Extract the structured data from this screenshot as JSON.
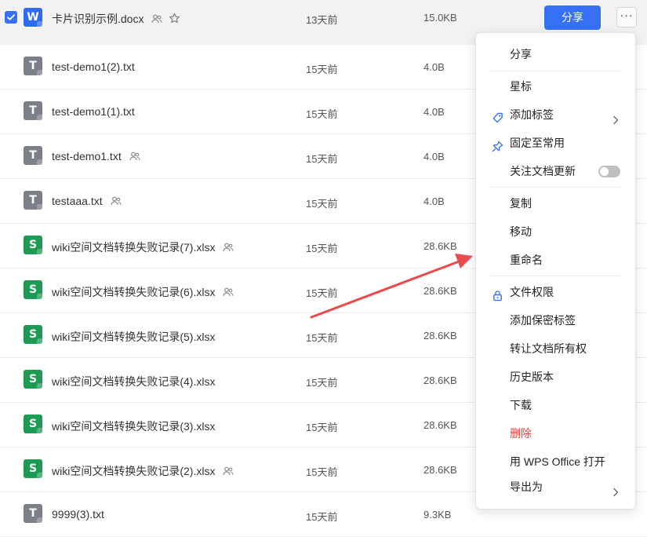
{
  "files": [
    {
      "type": "W",
      "name": "卡片识别示例.docx",
      "time": "13天前",
      "size": "15.0KB",
      "shared": true,
      "star": true,
      "selected": true
    },
    {
      "type": "T",
      "name": "test-demo1(2).txt",
      "time": "15天前",
      "size": "4.0B",
      "shared": false
    },
    {
      "type": "T",
      "name": "test-demo1(1).txt",
      "time": "15天前",
      "size": "4.0B",
      "shared": false
    },
    {
      "type": "T",
      "name": "test-demo1.txt",
      "time": "15天前",
      "size": "4.0B",
      "shared": true
    },
    {
      "type": "T",
      "name": "testaaa.txt",
      "time": "15天前",
      "size": "4.0B",
      "shared": true
    },
    {
      "type": "S",
      "name": "wiki空间文档转换失败记录(7).xlsx",
      "time": "15天前",
      "size": "28.6KB",
      "shared": true
    },
    {
      "type": "S",
      "name": "wiki空间文档转换失败记录(6).xlsx",
      "time": "15天前",
      "size": "28.6KB",
      "shared": true
    },
    {
      "type": "S",
      "name": "wiki空间文档转换失败记录(5).xlsx",
      "time": "15天前",
      "size": "28.6KB",
      "shared": false
    },
    {
      "type": "S",
      "name": "wiki空间文档转换失败记录(4).xlsx",
      "time": "15天前",
      "size": "28.6KB",
      "shared": false
    },
    {
      "type": "S",
      "name": "wiki空间文档转换失败记录(3).xlsx",
      "time": "15天前",
      "size": "28.6KB",
      "shared": false
    },
    {
      "type": "S",
      "name": "wiki空间文档转换失败记录(2).xlsx",
      "time": "15天前",
      "size": "28.6KB",
      "shared": true
    },
    {
      "type": "T",
      "name": "9999(3).txt",
      "time": "15天前",
      "size": "9.3KB",
      "shared": false
    }
  ],
  "share_button": "分享",
  "more_button": "···",
  "menu": [
    {
      "label": "分享"
    },
    {
      "sep": true
    },
    {
      "label": "星标"
    },
    {
      "label": "添加标签",
      "icon": "tag-icon",
      "submenu": true
    },
    {
      "label": "固定至常用",
      "icon": "pin-icon"
    },
    {
      "label": "关注文档更新",
      "toggle": true,
      "toggle_on": false
    },
    {
      "sep": true
    },
    {
      "label": "复制"
    },
    {
      "label": "移动"
    },
    {
      "label": "重命名"
    },
    {
      "sep": true
    },
    {
      "label": "文件权限",
      "icon": "lock-icon"
    },
    {
      "label": "添加保密标签"
    },
    {
      "label": "转让文档所有权"
    },
    {
      "label": "历史版本"
    },
    {
      "label": "下载"
    },
    {
      "label": "删除",
      "danger": true
    },
    {
      "label": "用 WPS Office 打开"
    },
    {
      "label": "导出为",
      "submenu": true
    }
  ],
  "colors": {
    "accent": "#3570f5",
    "word": "#2f6bf0",
    "text_file": "#7b7f88",
    "sheet": "#1d9b55",
    "danger": "#e0403d",
    "arrow": "#e84b4b"
  }
}
